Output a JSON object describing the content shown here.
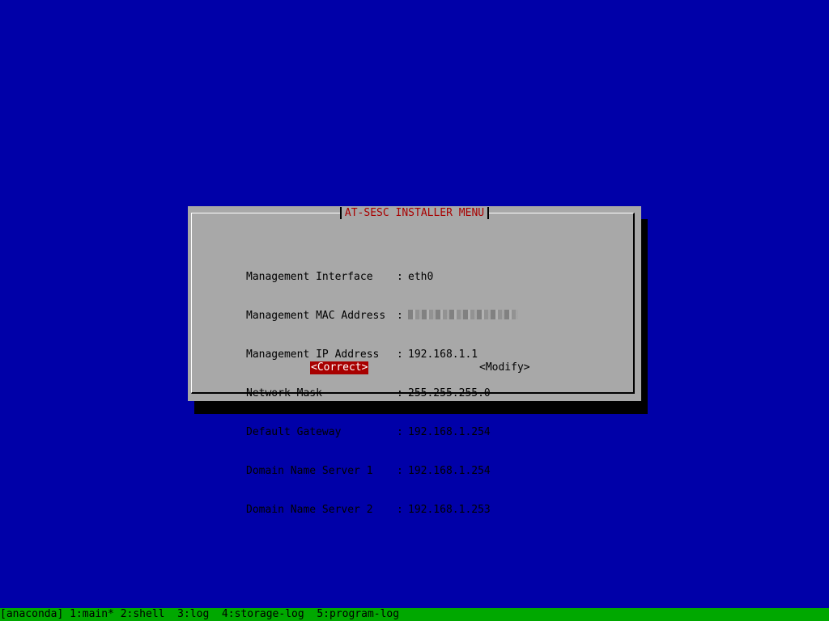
{
  "dialog": {
    "title": "AT-SESC INSTALLER MENU",
    "rows": [
      {
        "label": "Management Interface",
        "value": "eth0"
      },
      {
        "label": "Management MAC Address",
        "value": ""
      },
      {
        "label": "Management IP Address",
        "value": "192.168.1.1"
      },
      {
        "label": "Network Mask",
        "value": "255.255.255.0"
      },
      {
        "label": "Default Gateway",
        "value": "192.168.1.254"
      },
      {
        "label": "Domain Name Server 1",
        "value": "192.168.1.254"
      },
      {
        "label": "Domain Name Server 2",
        "value": "192.168.1.253"
      }
    ],
    "separator": ":",
    "buttons": {
      "correct": "<Correct>",
      "modify": "<Modify>"
    }
  },
  "statusbar": {
    "text": "[anaconda] 1:main* 2:shell  3:log  4:storage-log  5:program-log"
  },
  "colors": {
    "background": "#0000a8",
    "dialog": "#a8a8a8",
    "title": "#a80000",
    "selected_button_bg": "#a80000",
    "selected_button_fg": "#ffffff",
    "statusbar": "#00a800"
  }
}
